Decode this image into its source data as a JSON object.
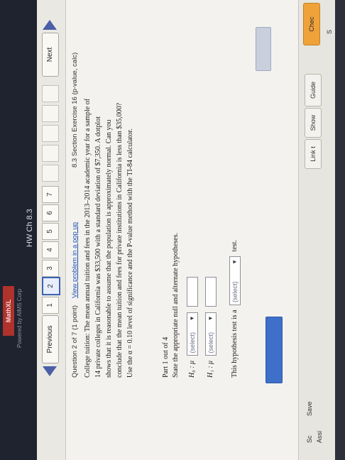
{
  "header": {
    "app_logo": "MathXL",
    "powered_by": "Powered by AIMS Corp",
    "hw_title": "HW Ch 8.3"
  },
  "nav": {
    "previous_label": "Previous",
    "question_numbers": [
      "1",
      "2",
      "3",
      "4",
      "5",
      "6",
      "7"
    ],
    "current_question": "2",
    "next_label": "Next"
  },
  "question": {
    "label": "Question 2 of 7 (1 point)",
    "popup_link": "View problem in a pop up",
    "exercise": "8.3 Section Exercise 16 (p-value, calc)",
    "text_lines": [
      "College tuition: The mean annual tuition and fees in the 2013–2014 academic year for a sample of",
      "14 private colleges in California was $33,500 with a standard deviation of $7,350. A dotplot",
      "shows that it is reasonable to assume that the population is approximately normal. Can you",
      "conclude that the mean tuition and fees for private institutions in California is less than $35,000?",
      "Use the α = 0.10 level of significance and the P-value method with the TI-84 calculator."
    ]
  },
  "part": {
    "label": "Part 1 out of 4",
    "instruction": "State the appropriate null and alternate hypotheses."
  },
  "hypotheses": {
    "h0_symbol": "H₀ : μ",
    "h1_symbol": "H₁ : μ",
    "select_placeholder": "(select)",
    "test_prefix": "This hypothesis test is a",
    "test_suffix": "test."
  },
  "right_panel": {
    "check_label": "Chec",
    "s_label": "S",
    "guide_label": "Guide",
    "show_label": "Show",
    "link_label": "Link t",
    "save_label": "Save",
    "assign_label": "Assi",
    "sub_label": "Sc"
  }
}
